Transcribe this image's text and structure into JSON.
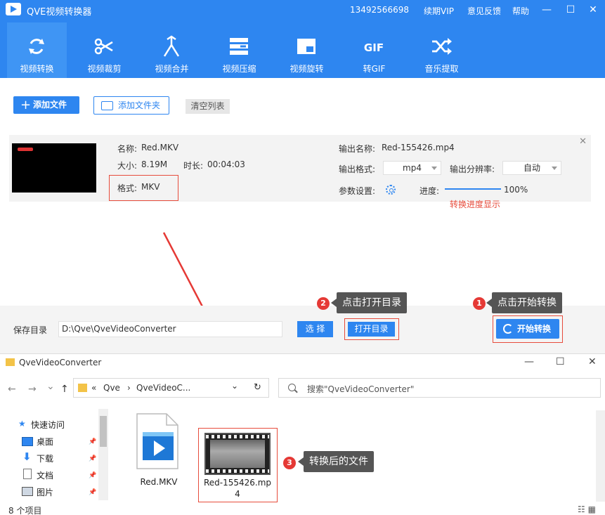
{
  "app": {
    "title": "QVE视频转换器",
    "phone": "13492566698",
    "vip": "续期VIP",
    "feedback": "意见反馈",
    "help": "帮助",
    "minimize": "—",
    "maximize": "☐",
    "close": "✕"
  },
  "nav": [
    {
      "label": "视频转换",
      "icon": "refresh-icon",
      "active": true
    },
    {
      "label": "视频裁剪",
      "icon": "scissors-icon"
    },
    {
      "label": "视频合并",
      "icon": "merge-icon"
    },
    {
      "label": "视频压缩",
      "icon": "compress-icon"
    },
    {
      "label": "视频旋转",
      "icon": "rotate-icon"
    },
    {
      "label": "转GIF",
      "icon": "gif-icon"
    },
    {
      "label": "音乐提取",
      "icon": "shuffle-icon"
    }
  ],
  "gif_glyph": "GIF",
  "toolbar": {
    "add_file": "添加文件",
    "add_folder": "添加文件夹",
    "clear_list": "清空列表"
  },
  "file": {
    "name_label": "名称:",
    "name": "Red.MKV",
    "size_label": "大小:",
    "size": "8.19M",
    "duration_label": "时长:",
    "duration": "00:04:03",
    "format_label": "格式:",
    "format": "MKV",
    "output_name_label": "输出名称:",
    "output_name": "Red-155426.mp4",
    "output_format_label": "输出格式:",
    "output_format": "mp4",
    "resolution_label": "输出分辨率:",
    "resolution": "自动",
    "params_label": "参数设置:",
    "progress_label": "进度:",
    "progress_text": "100%",
    "progress": 1.0,
    "progress_note": "转换进度显示"
  },
  "bottom": {
    "save_label": "保存目录",
    "save_path": "D:\\Qve\\QveVideoConverter",
    "select": "选 择",
    "open_dir": "打开目录",
    "start": "开始转换"
  },
  "callouts": {
    "one": {
      "num": "1",
      "text": "点击开始转换"
    },
    "two": {
      "num": "2",
      "text": "点击打开目录"
    },
    "three": {
      "num": "3",
      "text": "转换后的文件"
    }
  },
  "explorer": {
    "title": "QveVideoConverter",
    "min": "—",
    "max": "☐",
    "close": "✕",
    "back": "←",
    "forward": "→",
    "recent": "⌄",
    "up": "↑",
    "path_prefix": "«",
    "path_1": "Qve",
    "path_sep": "›",
    "path_2": "QveVideoC...",
    "path_dropdown": "⌄",
    "refresh": "↻",
    "search_placeholder": "搜索\"QveVideoConverter\"",
    "sidebar": [
      {
        "label": "快速访问"
      },
      {
        "label": "桌面"
      },
      {
        "label": "下载"
      },
      {
        "label": "文档"
      },
      {
        "label": "图片"
      }
    ],
    "pin": "📌",
    "files": [
      {
        "name": "Red.MKV"
      },
      {
        "name_line1": "Red-155426.mp",
        "name_line2": "4"
      }
    ],
    "status": "8 个项目",
    "view_toggle": "☷ ▦"
  },
  "colors": {
    "brand": "#2e86f0",
    "accent_red": "#e74c3c",
    "callout_bg": "#555555"
  }
}
